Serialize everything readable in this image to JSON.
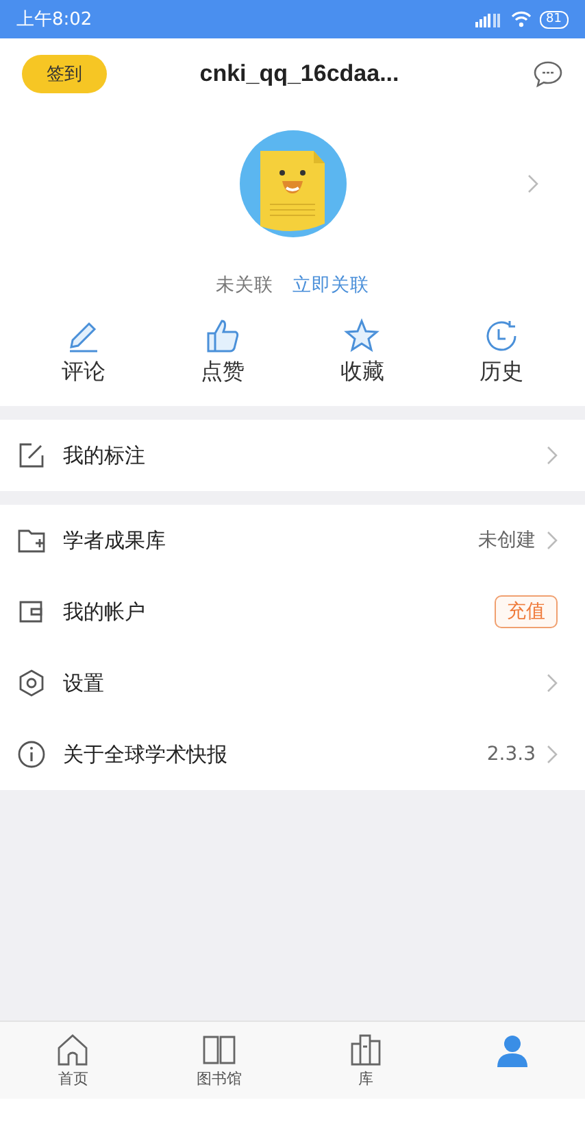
{
  "status_bar": {
    "time": "上午8:02",
    "battery": "81"
  },
  "header": {
    "checkin": "签到",
    "username": "cnki_qq_16cdaa..."
  },
  "profile": {
    "status": "未关联",
    "link": "立即关联"
  },
  "actions": [
    {
      "kind": "edit",
      "label": "评论"
    },
    {
      "kind": "like",
      "label": "点赞"
    },
    {
      "kind": "star",
      "label": "收藏"
    },
    {
      "kind": "history",
      "label": "历史"
    }
  ],
  "menu_groups": [
    [
      {
        "kind": "note",
        "label": "我的标注"
      }
    ],
    [
      {
        "kind": "library",
        "label": "学者成果库",
        "value": "未创建"
      },
      {
        "kind": "wallet",
        "label": "我的帐户",
        "badge": "充值"
      },
      {
        "kind": "settings",
        "label": "设置"
      },
      {
        "kind": "info",
        "label": "关于全球学术快报",
        "value": "2.3.3"
      }
    ]
  ],
  "tabs": [
    {
      "kind": "home",
      "label": "首页",
      "selected": false
    },
    {
      "kind": "book",
      "label": "图书馆",
      "selected": false
    },
    {
      "kind": "shelf",
      "label": "库",
      "selected": false
    },
    {
      "kind": "person",
      "selected": true
    }
  ]
}
